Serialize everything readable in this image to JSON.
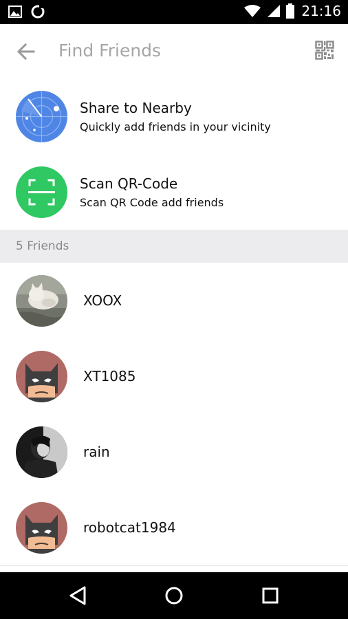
{
  "status_bar": {
    "time": "21:16"
  },
  "toolbar": {
    "title": "Find Friends"
  },
  "options": [
    {
      "title": "Share to Nearby",
      "subtitle": "Quickly add friends in your vicinity",
      "icon": "radar-icon",
      "color": "#4f86e6"
    },
    {
      "title": "Scan QR-Code",
      "subtitle": "Scan QR Code add friends",
      "icon": "scan-frame-icon",
      "color": "#2fc862"
    }
  ],
  "section": {
    "label": "5 Friends"
  },
  "friends": [
    {
      "name": "XOOX",
      "avatar": "cat-photo-avatar"
    },
    {
      "name": "XT1085",
      "avatar": "batman-avatar"
    },
    {
      "name": "rain",
      "avatar": "person-photo-avatar"
    },
    {
      "name": "robotcat1984",
      "avatar": "batman-avatar"
    }
  ],
  "colors": {
    "divider": "#e6e6e6",
    "section_bg": "#ececee",
    "title_gray": "#a6a6a6",
    "batman_bg": "#b06a65"
  }
}
